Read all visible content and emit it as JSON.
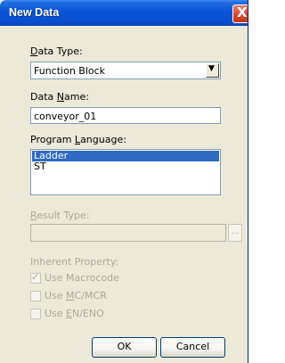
{
  "window": {
    "title": "New Data",
    "close_glyph": "X"
  },
  "data_type": {
    "label": "Data Type:",
    "value": "Function Block",
    "dropdown_arrow": "▼"
  },
  "data_name": {
    "label": "Data Name:",
    "value": "conveyor_01"
  },
  "program_language": {
    "label": "Program Language:",
    "options": [
      "Ladder",
      "ST"
    ],
    "selected": "Ladder"
  },
  "result_type": {
    "label": "Result Type:",
    "value": "",
    "browse_label": "..."
  },
  "inherent_property": {
    "label": "Inherent Property:",
    "use_macrocode": {
      "label": "Use Macrocode",
      "checked": true
    },
    "use_mc_mcr": {
      "label": "Use MC/MCR",
      "checked": false
    },
    "use_en_eno": {
      "label": "Use EN/ENO",
      "checked": false
    }
  },
  "buttons": {
    "ok": "OK",
    "cancel": "Cancel"
  },
  "colors": {
    "title_bar": "#0a54d6",
    "selection": "#316ac5",
    "dialog_bg": "#ece9d8",
    "disabled_text": "#aca899"
  }
}
